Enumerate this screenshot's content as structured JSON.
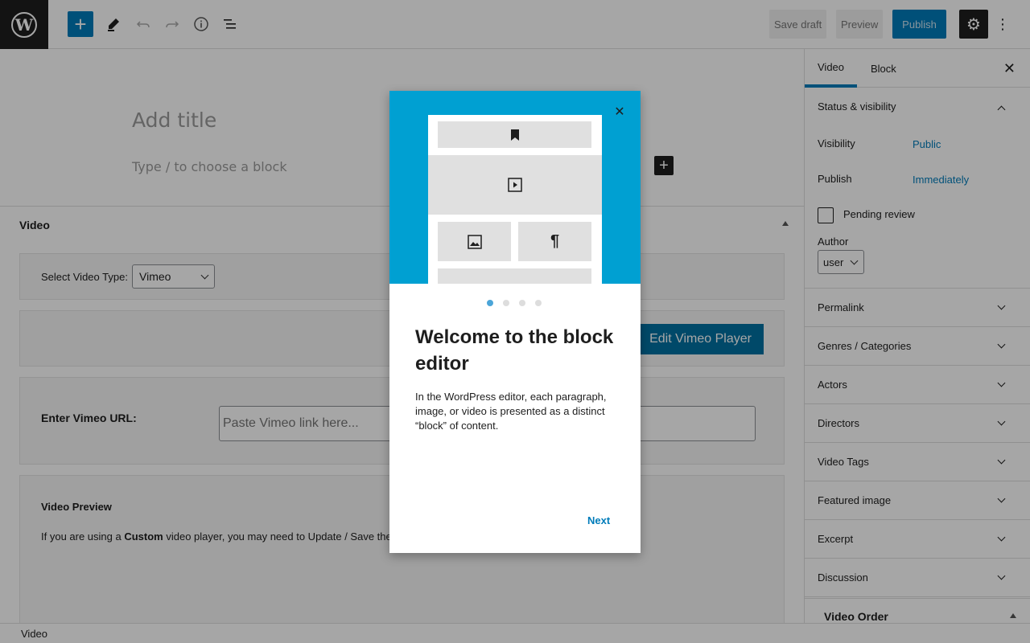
{
  "toolbar": {
    "save_draft": "Save draft",
    "preview": "Preview",
    "publish": "Publish",
    "accent": "#007cba"
  },
  "editor": {
    "title_placeholder": "Add title",
    "block_hint": "Type / to choose a block"
  },
  "metabox": {
    "title": "Video",
    "video_type_label": "Select Video Type:",
    "video_type_value": "Vimeo",
    "edit_player_label": "Edit Vimeo Player",
    "url_label": "Enter Vimeo URL:",
    "url_placeholder": "Paste Vimeo link here...",
    "preview_title": "Video Preview",
    "preview_text_before": "If you are using a ",
    "preview_text_bold": "Custom",
    "preview_text_after": " video player, you may need to Update / Save the"
  },
  "sidebar": {
    "tabs": [
      "Video",
      "Block"
    ],
    "status": {
      "title": "Status & visibility",
      "visibility_label": "Visibility",
      "visibility_value": "Public",
      "publish_label": "Publish",
      "publish_value": "Immediately",
      "pending_label": "Pending review",
      "author_label": "Author",
      "author_value": "user"
    },
    "sections": [
      "Permalink",
      "Genres / Categories",
      "Actors",
      "Directors",
      "Video Tags",
      "Featured image",
      "Excerpt",
      "Discussion"
    ],
    "video_order": "Video Order"
  },
  "footer": {
    "breadcrumb": "Video"
  },
  "modal": {
    "heading": "Welcome to the block editor",
    "text": "In the WordPress editor, each paragraph, image, or video is presented as a distinct “block” of content.",
    "next": "Next",
    "hero_color": "#00a0d2"
  }
}
